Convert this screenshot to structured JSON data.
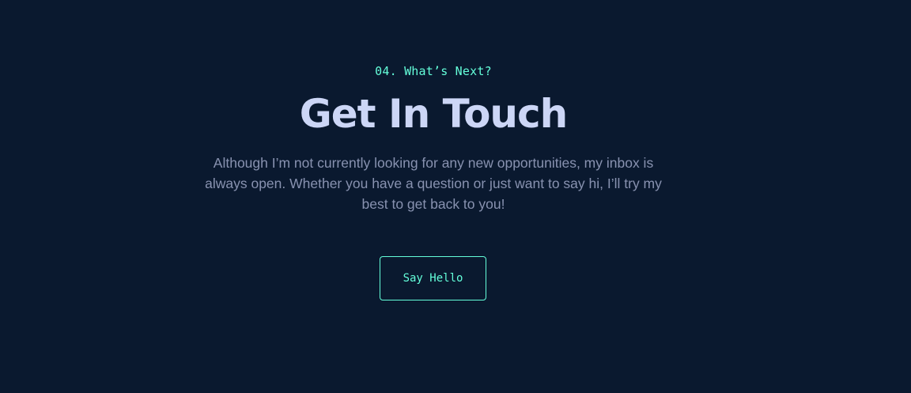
{
  "contact": {
    "overline": "04. What’s Next?",
    "title": "Get In Touch",
    "description": "Although I’m not currently looking for any new opportunities, my inbox is always open. Whether you have a question or just want to say hi, I’ll try my best to get back to you!",
    "button_label": "Say Hello"
  },
  "colors": {
    "background": "#0a192f",
    "accent": "#64ffda",
    "heading": "#ccd6f6",
    "body_text": "#8892b0"
  }
}
